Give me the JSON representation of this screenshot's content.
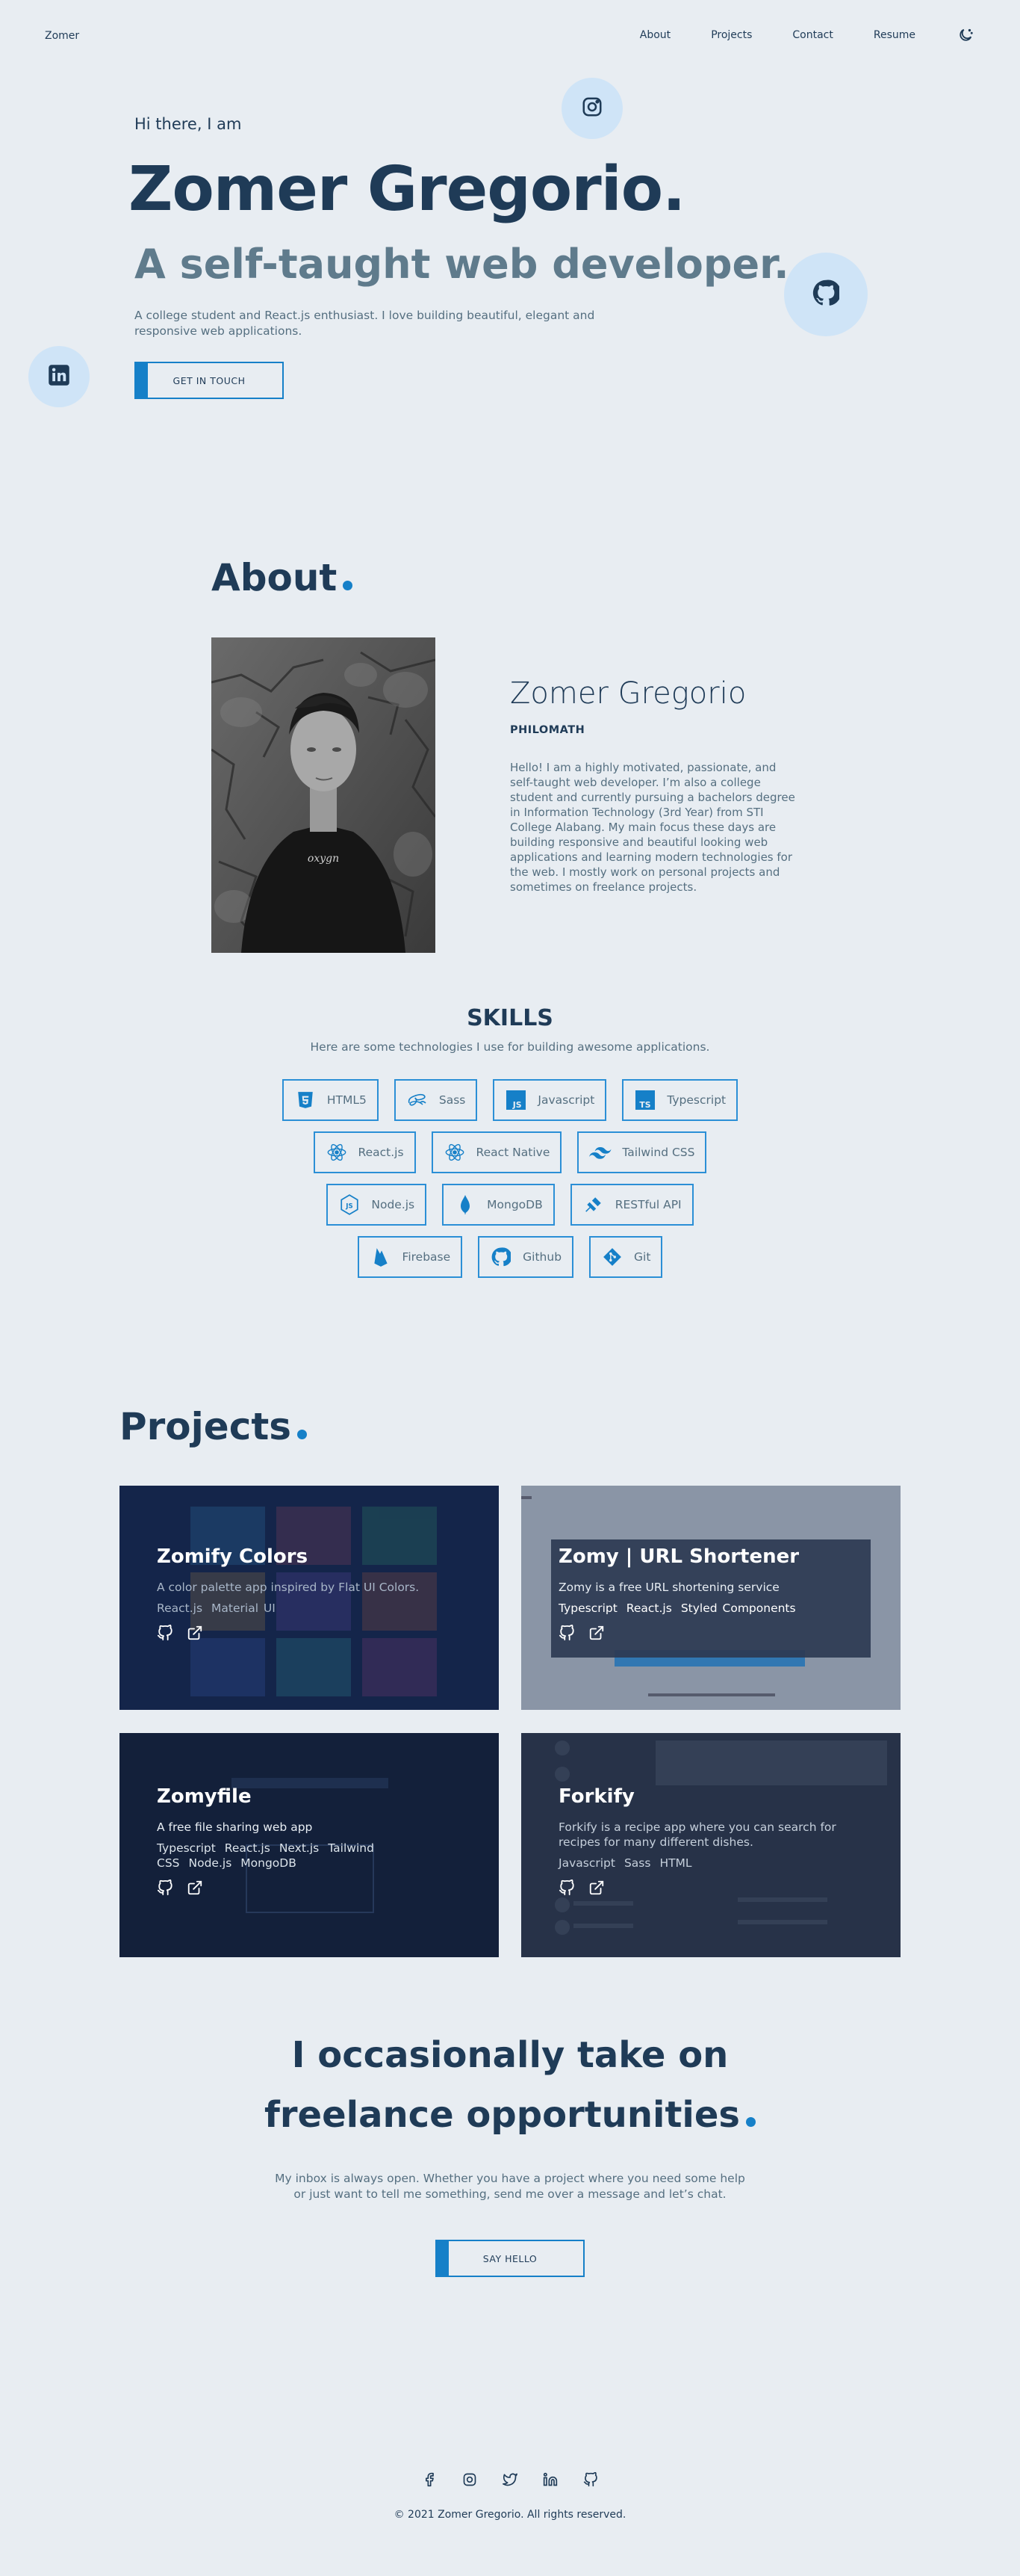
{
  "nav": {
    "brand": "Zomer",
    "links": [
      "About",
      "Projects",
      "Contact",
      "Resume"
    ],
    "theme_toggle_icon": "moon-icon"
  },
  "hero": {
    "greeting": "Hi there, I am",
    "name": "Zomer Gregorio.",
    "role": "A self-taught web developer.",
    "description": "A college student and React.js enthusiast. I love building beautiful, elegant and responsive web applications.",
    "cta_label": "GET IN TOUCH"
  },
  "about": {
    "title": "About",
    "name": "Zomer Gregorio",
    "tagline": "PHILOMATH",
    "bio": "Hello! I am a highly motivated, passionate, and self-taught web developer. I’m also a college student and currently pursuing a bachelors degree in Information Technology (3rd Year) from STI College Alabang. My main focus these days are building responsive and beautiful looking web applications and learning modern technologies for the web. I mostly work on personal projects and sometimes on freelance projects.",
    "photo_shirt_text": "oxygn"
  },
  "skills": {
    "title": "SKILLS",
    "subtitle": "Here are some technologies I use for building awesome applications.",
    "rows": [
      [
        {
          "name": "HTML5",
          "icon": "html5-icon"
        },
        {
          "name": "Sass",
          "icon": "sass-icon"
        },
        {
          "name": "Javascript",
          "icon": "javascript-icon"
        },
        {
          "name": "Typescript",
          "icon": "typescript-icon"
        }
      ],
      [
        {
          "name": "React.js",
          "icon": "react-icon"
        },
        {
          "name": "React Native",
          "icon": "react-native-icon"
        },
        {
          "name": "Tailwind CSS",
          "icon": "tailwind-icon"
        }
      ],
      [
        {
          "name": "Node.js",
          "icon": "nodejs-icon"
        },
        {
          "name": "MongoDB",
          "icon": "mongodb-icon"
        },
        {
          "name": "RESTful API",
          "icon": "api-icon"
        }
      ],
      [
        {
          "name": "Firebase",
          "icon": "firebase-icon"
        },
        {
          "name": "Github",
          "icon": "github-icon"
        },
        {
          "name": "Git",
          "icon": "git-icon"
        }
      ]
    ]
  },
  "projects": {
    "title": "Projects",
    "items": [
      {
        "title": "Zomify Colors",
        "description": "A color palette app inspired by Flat UI Colors.",
        "tags": [
          "React.js",
          "Material UI"
        ]
      },
      {
        "title": "Zomy | URL Shortener",
        "description": "Zomy is a free URL shortening service",
        "tags": [
          "Typescript",
          "React.js",
          "Styled Components"
        ]
      },
      {
        "title": "Zomyfile",
        "description": "A free file sharing web app",
        "tags": [
          "Typescript",
          "React.js",
          "Next.js",
          "Tailwind CSS",
          "Node.js",
          "MongoDB"
        ]
      },
      {
        "title": "Forkify",
        "description": "Forkify is a recipe app where you can search for recipes for many different dishes.",
        "tags": [
          "Javascript",
          "Sass",
          "HTML"
        ]
      }
    ]
  },
  "contact": {
    "title_line1": "I occasionally take on",
    "title_line2": "freelance opportunities",
    "text": "My inbox is always open. Whether you have a project where you need some help or just want to tell me something, send me over a message and let’s chat.",
    "cta_label": "SAY HELLO"
  },
  "footer": {
    "icons": [
      "facebook-icon",
      "instagram-icon",
      "twitter-icon",
      "linkedin-icon",
      "github-icon"
    ],
    "copyright": "© 2021 Zomer Gregorio. All rights reserved."
  },
  "colors": {
    "background": "#e8edf2",
    "primary_text": "#1f3b57",
    "secondary_text": "#556f80",
    "accent": "#1680c8",
    "bubble": "#cfe4f7"
  }
}
